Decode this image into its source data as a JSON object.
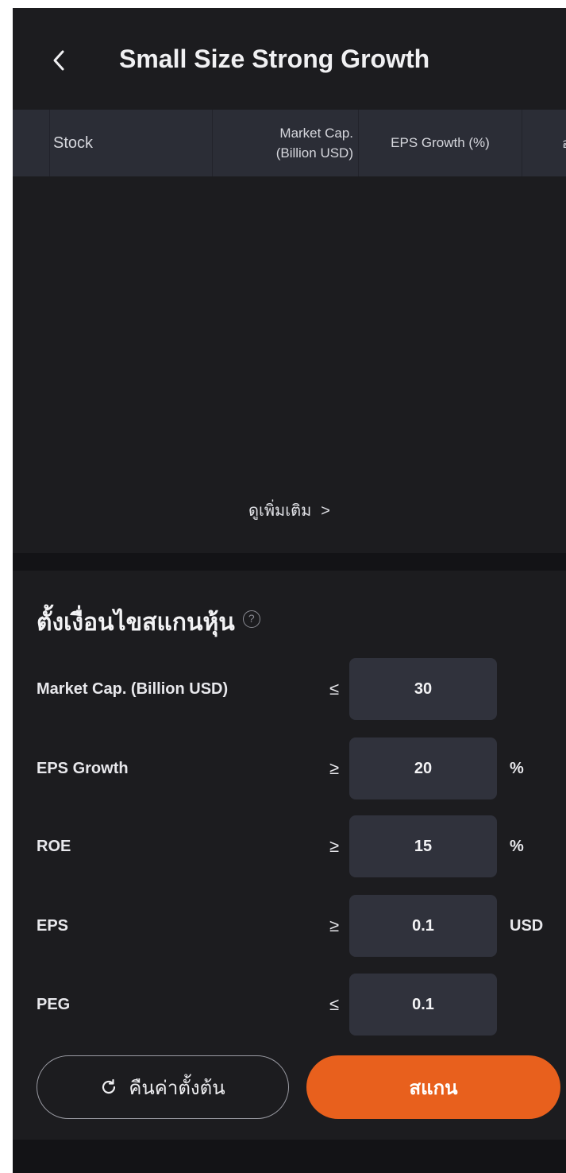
{
  "header": {
    "back_icon": "chevron-left-icon",
    "title": "Small Size Strong Growth"
  },
  "table": {
    "columns": [
      {
        "label": "Stock"
      },
      {
        "label_line1": "Market Cap.",
        "label_line2": "(Billion USD)"
      },
      {
        "label": "EPS Growth (%)"
      },
      {
        "label": "อ"
      }
    ],
    "rows": [],
    "see_more": "ดูเพิ่มเติม",
    "see_more_chevron": ">"
  },
  "screener": {
    "title": "ตั้งเงื่อนไขสแกนหุ้น",
    "info_icon": "info-circle-icon",
    "criteria": [
      {
        "label": "Market Cap. (Billion USD)",
        "op": "≤",
        "value": "30",
        "unit": ""
      },
      {
        "label": "EPS Growth",
        "op": "≥",
        "value": "20",
        "unit": "%"
      },
      {
        "label": "ROE",
        "op": "≥",
        "value": "15",
        "unit": "%"
      },
      {
        "label": "EPS",
        "op": "≥",
        "value": "0.1",
        "unit": "USD"
      },
      {
        "label": "PEG",
        "op": "≤",
        "value": "0.1",
        "unit": ""
      }
    ]
  },
  "actions": {
    "reset_label": "คืนค่าตั้งต้น",
    "reset_icon": "refresh-icon",
    "scan_label": "สแกน"
  },
  "colors": {
    "background": "#1c1c1f",
    "table_header": "#2b2d36",
    "input_bg": "#30323c",
    "accent": "#e8601d"
  }
}
